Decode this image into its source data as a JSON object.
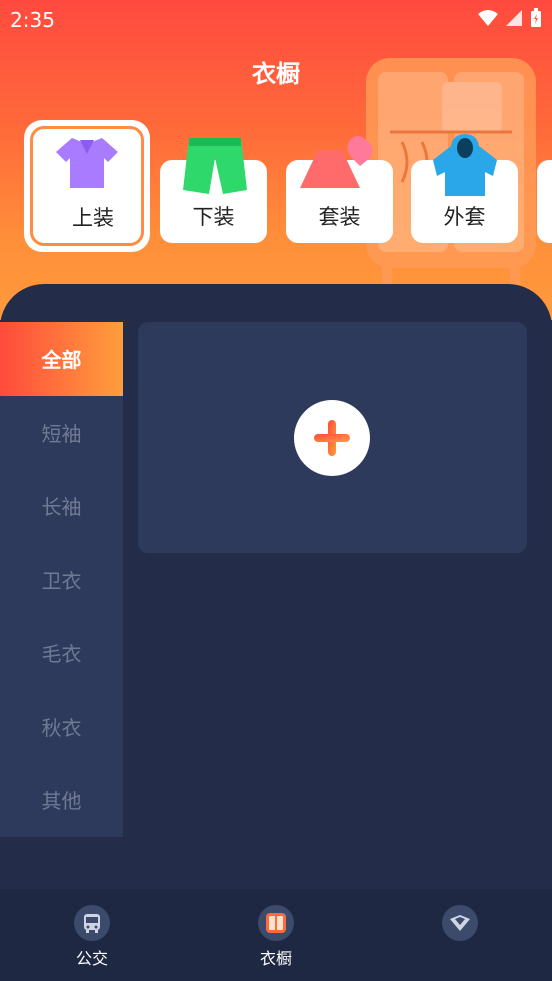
{
  "status_bar": {
    "time": "2:35"
  },
  "header": {
    "title": "衣橱"
  },
  "categories": [
    {
      "label": "上装",
      "icon": "shirt-icon",
      "active": true
    },
    {
      "label": "下装",
      "icon": "shorts-icon",
      "active": false
    },
    {
      "label": "套装",
      "icon": "dress-icon",
      "active": false
    },
    {
      "label": "外套",
      "icon": "jacket-icon",
      "active": false
    }
  ],
  "sidebar": {
    "items": [
      {
        "label": "全部",
        "active": true
      },
      {
        "label": "短袖"
      },
      {
        "label": "长袖"
      },
      {
        "label": "卫衣"
      },
      {
        "label": "毛衣"
      },
      {
        "label": "秋衣"
      },
      {
        "label": "其他"
      }
    ]
  },
  "bottom_nav": {
    "items": [
      {
        "label": "公交",
        "icon": "bus-icon"
      },
      {
        "label": "衣橱",
        "icon": "wardrobe-icon",
        "active": true
      },
      {
        "label": "",
        "icon": "shield-icon"
      }
    ]
  },
  "colors": {
    "accent_start": "#ff4b3c",
    "accent_end": "#ff9e3c",
    "panel": "#232d4a",
    "card": "#2e3a5b"
  }
}
